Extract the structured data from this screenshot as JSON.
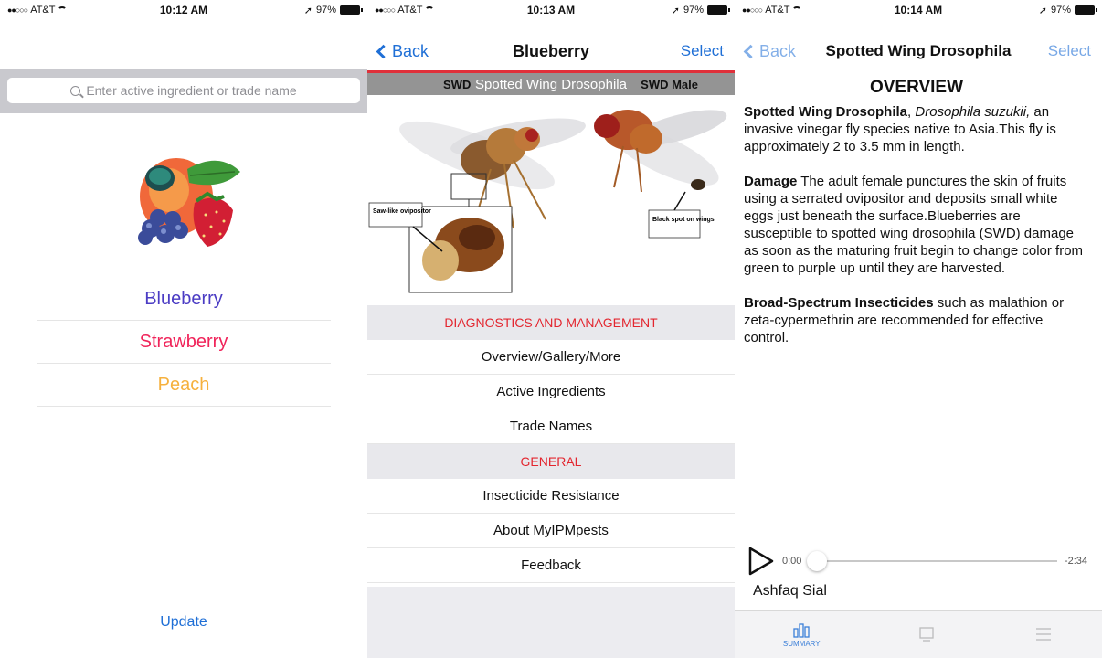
{
  "screens": [
    {
      "status": {
        "carrier": "AT&T",
        "time": "10:12 AM",
        "battery": "97%"
      },
      "search": {
        "placeholder": "Enter active ingredient or trade name"
      },
      "crops": [
        {
          "label": "Blueberry",
          "color": "#4b3cc4"
        },
        {
          "label": "Strawberry",
          "color": "#f0245a"
        },
        {
          "label": "Peach",
          "color": "#f6b13e"
        }
      ],
      "update_label": "Update"
    },
    {
      "status": {
        "carrier": "AT&T",
        "time": "10:13 AM",
        "battery": "97%"
      },
      "nav": {
        "back": "Back",
        "title": "Blueberry",
        "select": "Select"
      },
      "hero": {
        "caption": "Spotted Wing Drosophila",
        "left_label": "SWD",
        "right_label": "SWD Male",
        "callout_ovipositor": "Saw-like ovipositor",
        "callout_spot": "Black spot on wings"
      },
      "sections": [
        {
          "header": "DIAGNOSTICS AND MANAGEMENT",
          "items": [
            "Overview/Gallery/More",
            "Active Ingredients",
            "Trade Names"
          ]
        },
        {
          "header": "GENERAL",
          "items": [
            "Insecticide Resistance",
            "About MyIPMpests",
            "Feedback"
          ]
        }
      ]
    },
    {
      "status": {
        "carrier": "AT&T",
        "time": "10:14 AM",
        "battery": "97%"
      },
      "nav": {
        "back": "Back",
        "title": "Spotted Wing Drosophila",
        "select": "Select"
      },
      "article": {
        "heading": "OVERVIEW",
        "p1_bold": "Spotted Wing Drosophila",
        "p1_sep": ", ",
        "p1_italic": "Drosophila suzukii,",
        "p1_rest": " an invasive vinegar fly species native to Asia.This  fly is approximately 2 to 3.5 mm in length.",
        "p2_bold": "Damage",
        "p2_rest": " The adult female punctures the skin of fruits using a serrated ovipositor and deposits small white eggs just beneath the surface.Blueberries are susceptible to spotted wing drosophila (SWD) damage as soon as the maturing fruit begin to change color from green to purple up until they are harvested.",
        "p3_bold": "Broad-Spectrum Insecticides",
        "p3_rest": " such as malathion or zeta-cypermethrin are recommended for effective control."
      },
      "player": {
        "elapsed": "0:00",
        "remaining": "-2:34",
        "progress": 0.0
      },
      "author": "Ashfaq Sial",
      "tabs": [
        {
          "label": "SUMMARY",
          "icon": "chart-icon",
          "active": true
        },
        {
          "label": "",
          "icon": "gallery-icon",
          "active": false
        },
        {
          "label": "",
          "icon": "menu-icon",
          "active": false
        }
      ]
    }
  ]
}
